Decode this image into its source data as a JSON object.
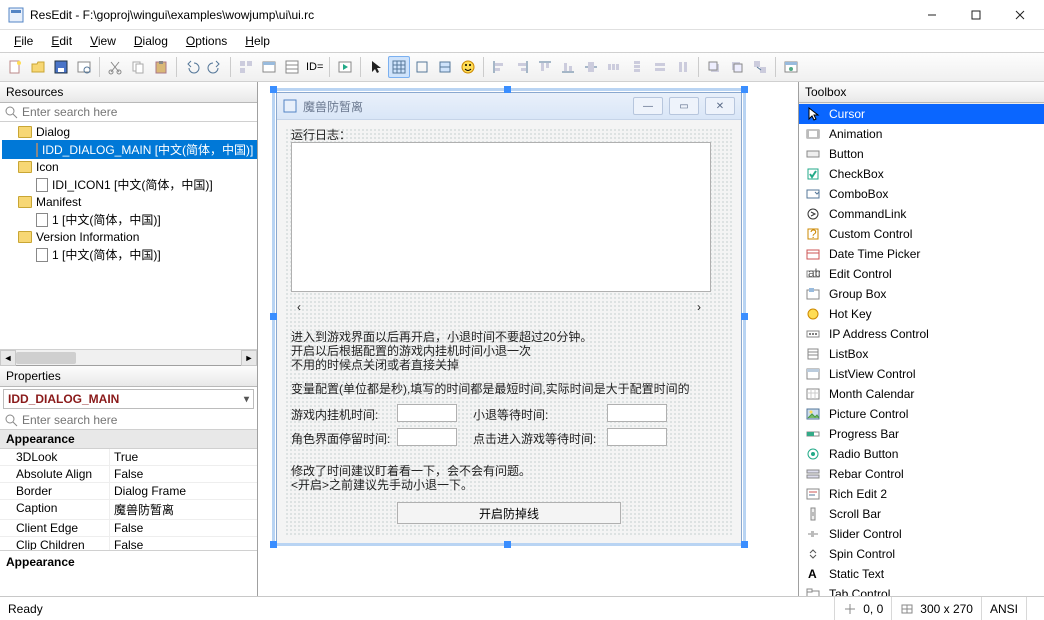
{
  "window": {
    "title": "ResEdit - F:\\goproj\\wingui\\examples\\wowjump\\ui\\ui.rc"
  },
  "menu": {
    "file": "File",
    "edit": "Edit",
    "view": "View",
    "dialog": "Dialog",
    "options": "Options",
    "help": "Help"
  },
  "toolbar": {
    "id_label": "ID="
  },
  "resources_panel": {
    "title": "Resources",
    "search_placeholder": "Enter search here",
    "folders": {
      "dialog": "Dialog",
      "dialog_item": "IDD_DIALOG_MAIN [中文(简体，中国)]",
      "icon": "Icon",
      "icon_item": "IDI_ICON1 [中文(简体，中国)]",
      "manifest": "Manifest",
      "manifest_item": "1 [中文(简体，中国)]",
      "version": "Version Information",
      "version_item": "1 [中文(简体，中国)]"
    }
  },
  "properties_panel": {
    "title": "Properties",
    "combo": "IDD_DIALOG_MAIN",
    "search_placeholder": "Enter search here",
    "group": "Appearance",
    "rows": [
      {
        "k": "3DLook",
        "v": "True"
      },
      {
        "k": "Absolute Align",
        "v": "False"
      },
      {
        "k": "Border",
        "v": "Dialog Frame"
      },
      {
        "k": "Caption",
        "v": "魔兽防暂离"
      },
      {
        "k": "Client Edge",
        "v": "False"
      },
      {
        "k": "Clip Children",
        "v": "False"
      }
    ],
    "desc_title": "Appearance"
  },
  "dialog": {
    "caption": "魔兽防暂离",
    "group_label": "运行日志：",
    "text1": "进入到游戏界面以后再开启，小退时间不要超过20分钟。",
    "text2": "开启以后根据配置的游戏内挂机时间小退一次",
    "text3": "不用的时候点关闭或者直接关掉",
    "text4": "变量配置(单位都是秒),填写的时间都是最短时间,实际时间是大于配置时间的",
    "label_a": "游戏内挂机时间:",
    "label_b": "小退等待时间:",
    "label_c": "角色界面停留时间:",
    "label_d": "点击进入游戏等待时间:",
    "text5": "修改了时间建议盯着看一下，会不会有问题。",
    "text6": "<开启>之前建议先手动小退一下。",
    "button": "开启防掉线"
  },
  "toolbox_panel": {
    "title": "Toolbox",
    "items": [
      "Cursor",
      "Animation",
      "Button",
      "CheckBox",
      "ComboBox",
      "CommandLink",
      "Custom Control",
      "Date Time Picker",
      "Edit Control",
      "Group Box",
      "Hot Key",
      "IP Address Control",
      "ListBox",
      "ListView Control",
      "Month Calendar",
      "Picture Control",
      "Progress Bar",
      "Radio Button",
      "Rebar Control",
      "Rich Edit 2",
      "Scroll Bar",
      "Slider Control",
      "Spin Control",
      "Static Text",
      "Tab Control"
    ]
  },
  "status": {
    "ready": "Ready",
    "coords": "0, 0",
    "size": "300 x 270",
    "enc": "ANSI"
  }
}
